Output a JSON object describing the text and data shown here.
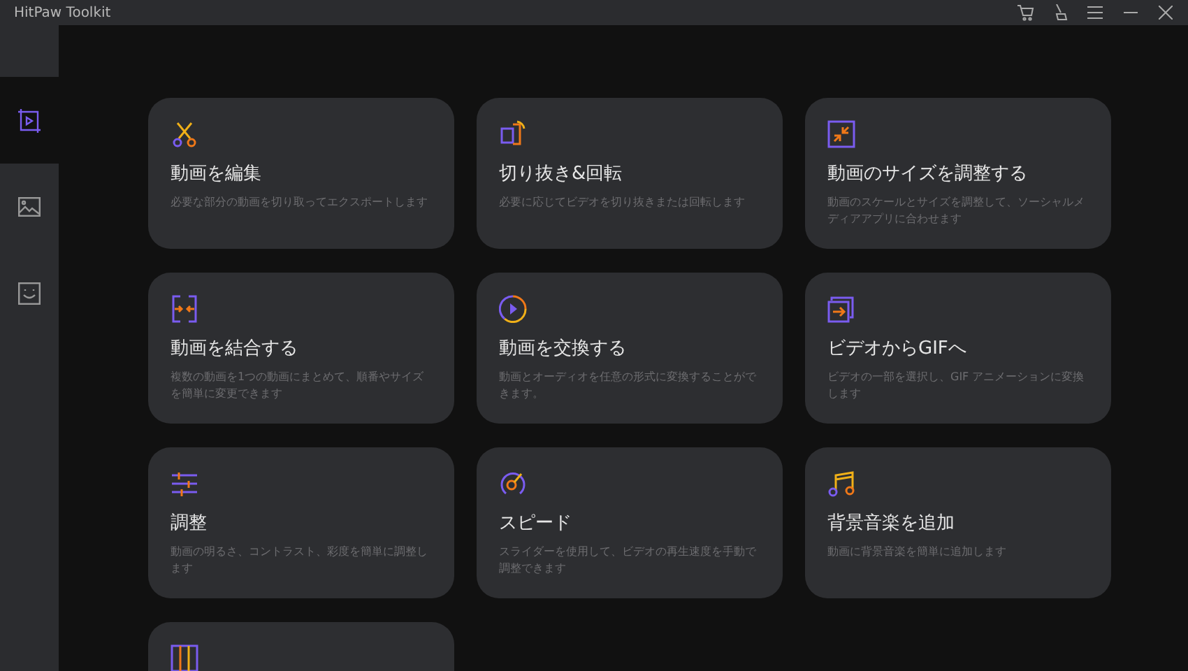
{
  "window": {
    "title": "HitPaw Toolkit"
  },
  "sidebar": {
    "items": [
      {
        "kind": "video",
        "selected": true
      },
      {
        "kind": "image",
        "selected": false
      },
      {
        "kind": "face",
        "selected": false
      }
    ]
  },
  "cards": [
    {
      "kind": "edit",
      "title": "動画を編集",
      "description": "必要な部分の動画を切り取ってエクスポートします"
    },
    {
      "kind": "crop",
      "title": "切り抜き&回転",
      "description": "必要に応じてビデオを切り抜きまたは回転します"
    },
    {
      "kind": "resize",
      "title": "動画のサイズを調整する",
      "description": "動画のスケールとサイズを調整して、ソーシャルメディアアプリに合わせます"
    },
    {
      "kind": "merge",
      "title": "動画を結合する",
      "description": "複数の動画を1つの動画にまとめて、順番やサイズを簡単に変更できます"
    },
    {
      "kind": "convert",
      "title": "動画を交換する",
      "description": "動画とオーディオを任意の形式に変換することができます。"
    },
    {
      "kind": "gif",
      "title": "ビデオからGIFへ",
      "description": "ビデオの一部を選択し、GIF アニメーションに変換します"
    },
    {
      "kind": "adjust",
      "title": "調整",
      "description": "動画の明るさ、コントラスト、彩度を簡単に調整します"
    },
    {
      "kind": "speed",
      "title": "スピード",
      "description": "スライダーを使用して、ビデオの再生速度を手動で調整できます"
    },
    {
      "kind": "music",
      "title": "背景音楽を追加",
      "description": "動画に背景音楽を簡単に追加します"
    },
    {
      "kind": "split"
    }
  ]
}
